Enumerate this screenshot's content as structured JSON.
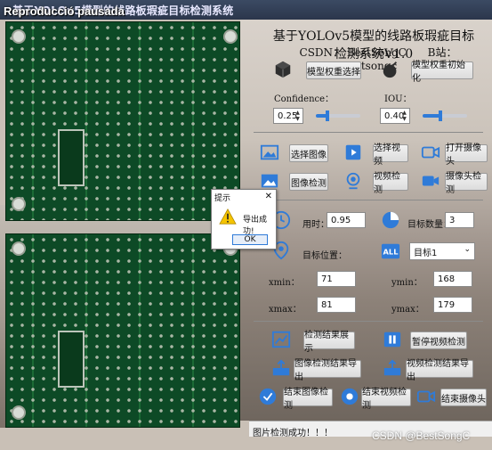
{
  "window": {
    "title": "基于YOLOv5模型的线路板瑕疵目标检测系统",
    "overlay": "Reproducció pausada"
  },
  "header": {
    "title": "基于YOLOv5模型的线路板瑕疵目标检测系统V1.0",
    "csdn": "CSDN： BestSongC",
    "bilibili": "B站：Bestsongc"
  },
  "model": {
    "select_label": "模型权重选择",
    "init_label": "模型权重初始化"
  },
  "params": {
    "confidence_label": "Confidence：",
    "confidence_value": "0.25",
    "confidence_level": 0.25,
    "iou_label": "IOU：",
    "iou_value": "0.40",
    "iou_level": 0.4
  },
  "actions": {
    "select_image": "选择图像",
    "select_video": "选择视频",
    "open_camera": "打开摄像头",
    "image_detect": "图像检测",
    "video_detect": "视频检测",
    "camera_detect": "摄像头检测"
  },
  "results": {
    "time_label": "用时：",
    "time_value": "0.95",
    "count_label": "目标数量：",
    "count_value": "3",
    "position_label": "目标位置：",
    "target_select": "目标1",
    "xmin_label": "xmin：",
    "xmin_value": "71",
    "ymin_label": "ymin：",
    "ymin_value": "168",
    "xmax_label": "xmax：",
    "xmax_value": "81",
    "ymax_label": "ymax：",
    "ymax_value": "179"
  },
  "bottom": {
    "show_results": "检测结果展示",
    "pause_video": "暂停视频检测",
    "export_image": "图像检测结果导出",
    "export_video": "视频检测结果导出",
    "end_image": "结束图像检测",
    "end_video": "结束视频检测",
    "end_camera": "结束摄像头"
  },
  "status": {
    "text": "图片检测成功！！！"
  },
  "dialog": {
    "title": "提示",
    "message": "导出成功!",
    "ok": "OK",
    "close": "✕"
  },
  "watermark": "CSDN @BestSongC",
  "colors": {
    "accent": "#2f7bd8",
    "pcb": "#0d4a26"
  }
}
